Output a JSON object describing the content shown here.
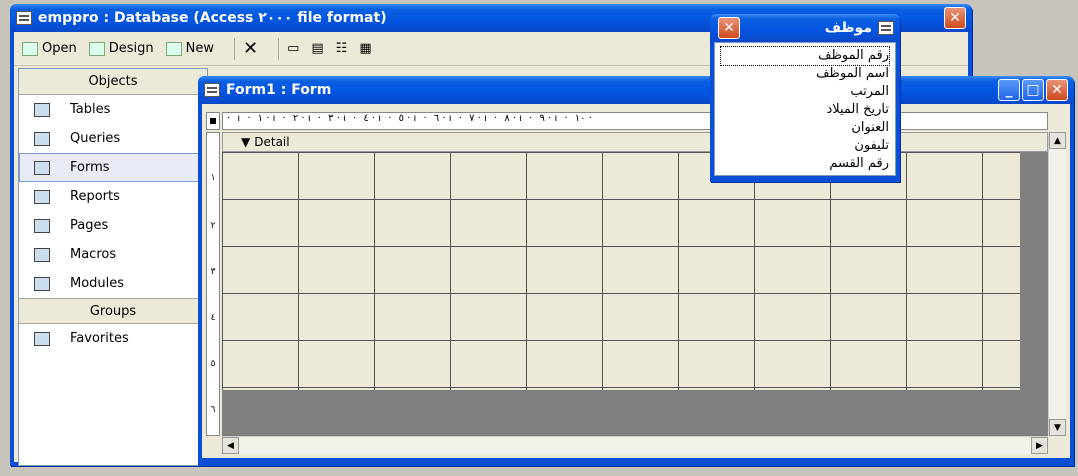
{
  "db_window": {
    "title": "emppro : Database (Access ٢٠٠٠ file format)",
    "toolbar": {
      "open": "Open",
      "design": "Design",
      "new": "New"
    },
    "objects_header": "Objects",
    "objects": [
      "Tables",
      "Queries",
      "Forms",
      "Reports",
      "Pages",
      "Macros",
      "Modules"
    ],
    "selected_object": "Forms",
    "groups_header": "Groups",
    "groups": [
      "Favorites"
    ]
  },
  "form_window": {
    "title": "Form1 : Form",
    "section": "Detail",
    "ruler_top": "· ı · ١ · ı · ٢ · ı · ٣ · ı · ٤ · ı · ٥ · ı · ٦ · ı · ٧ · ı · ٨ · ı · ٩ · ı · ١٠ ·",
    "ruler_left": [
      "١",
      "٢",
      "٣",
      "٤",
      "٥",
      "٦"
    ]
  },
  "field_list": {
    "title": "موظف",
    "fields": [
      "رقم الموظف",
      "اسم الموظف",
      "المرتب",
      "تاريخ الميلاد",
      "العنوان",
      "تليفون",
      "رقم القسم"
    ],
    "selected_index": 0
  }
}
